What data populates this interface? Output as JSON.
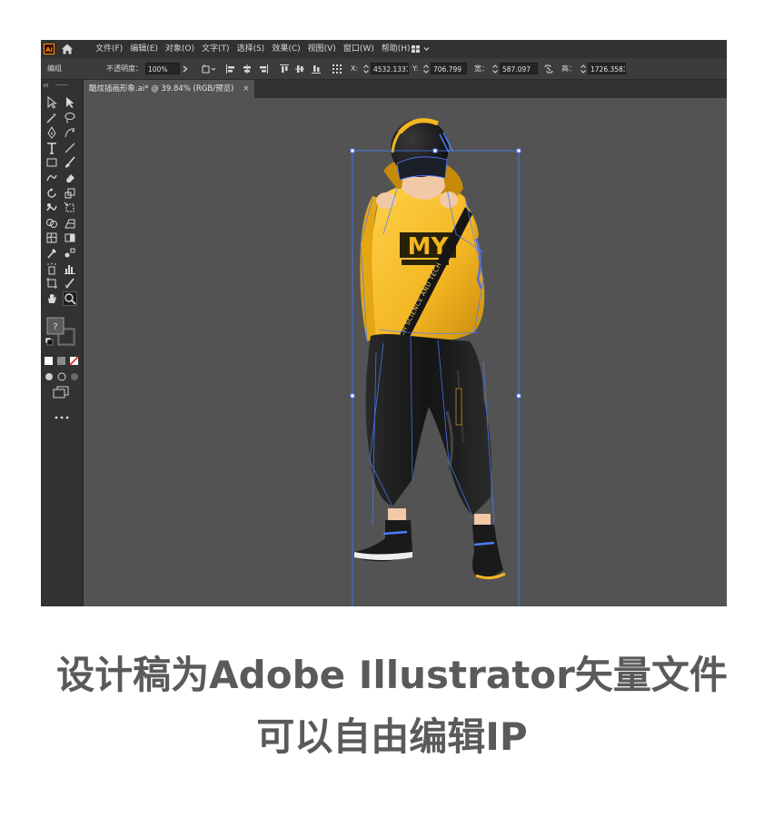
{
  "menubar": {
    "logo": "Ai",
    "items": [
      "文件(F)",
      "编辑(E)",
      "对象(O)",
      "文字(T)",
      "选择(S)",
      "效果(C)",
      "视图(V)",
      "窗口(W)",
      "帮助(H)"
    ]
  },
  "control_bar": {
    "selection_label": "编组",
    "opacity_label": "不透明度：",
    "opacity_value": "100%",
    "x_label": "X:",
    "x_value": "4532.1337",
    "y_label": "Y:",
    "y_value": "706.799",
    "w_label": "宽：",
    "w_value": "587.097",
    "h_label": "高：",
    "h_value": "1726.3583"
  },
  "document_tab": {
    "title": "酷炫插画形象.ai* @ 39.84% (RGB/预览)",
    "close": "×"
  },
  "artwork": {
    "shirt_logo": "MY",
    "strap_text": "LOGITECH SCIENCE AND TECH"
  },
  "caption": {
    "line1": "设计稿为Adobe Illustrator矢量文件",
    "line2": "可以自由编辑IP"
  },
  "colors": {
    "ui_dark": "#323232",
    "canvas": "#535353",
    "selection": "#4a7cff",
    "jacket": "#f3b622",
    "pants": "#1d1d1d",
    "caption": "#5a5a5a"
  }
}
